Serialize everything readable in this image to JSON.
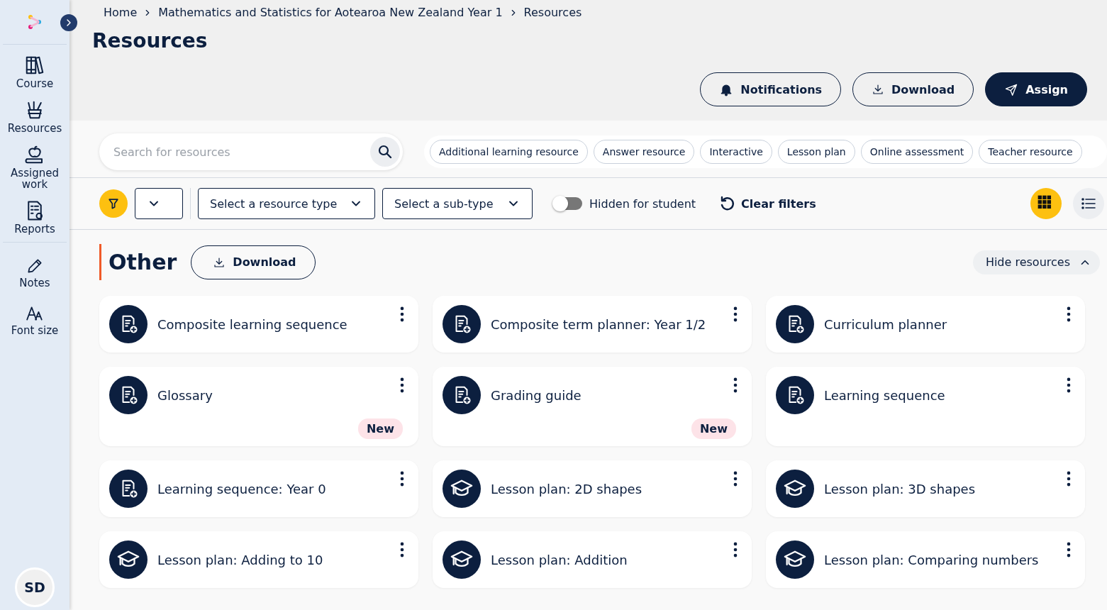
{
  "sidebar": {
    "items": [
      {
        "label": "Course"
      },
      {
        "label": "Resources"
      },
      {
        "label": "Assigned work"
      },
      {
        "label": "Reports"
      }
    ],
    "tools": [
      {
        "label": "Notes"
      },
      {
        "label": "Font size"
      }
    ],
    "avatar": "SD"
  },
  "breadcrumbs": [
    "Home",
    "Mathematics and Statistics for Aotearoa New Zealand Year 1",
    "Resources"
  ],
  "page_title": "Resources",
  "header_buttons": [
    {
      "label": "Notifications",
      "kind": "outline"
    },
    {
      "label": "Download",
      "kind": "outline"
    },
    {
      "label": "Assign",
      "kind": "filled"
    }
  ],
  "search": {
    "placeholder": "Search for resources"
  },
  "chips": [
    "Additional learning resource",
    "Answer resource",
    "Interactive",
    "Lesson plan",
    "Online assessment",
    "Teacher resource"
  ],
  "filters": {
    "resource_type": "Select a resource type",
    "sub_type": "Select a sub-type",
    "hidden_toggle": {
      "label": "Hidden for student",
      "on": false
    },
    "clear": "Clear filters"
  },
  "views": [
    {
      "kind": "grid",
      "selected": true
    },
    {
      "kind": "list",
      "selected": false
    }
  ],
  "section": {
    "title": "Other",
    "download": "Download",
    "hide": "Hide resources"
  },
  "cards": [
    {
      "title": "Composite learning sequence",
      "kind": "document"
    },
    {
      "title": "Composite term planner: Year 1/2",
      "kind": "document"
    },
    {
      "title": "Curriculum planner",
      "kind": "document"
    },
    {
      "title": "Glossary",
      "kind": "document",
      "badge": "New"
    },
    {
      "title": "Grading guide",
      "kind": "document",
      "badge": "New"
    },
    {
      "title": "Learning sequence",
      "kind": "document"
    },
    {
      "title": "Learning sequence: Year 0",
      "kind": "document"
    },
    {
      "title": "Lesson plan: 2D shapes",
      "kind": "cap"
    },
    {
      "title": "Lesson plan: 3D shapes",
      "kind": "cap"
    },
    {
      "title": "Lesson plan: Adding to 10",
      "kind": "cap"
    },
    {
      "title": "Lesson plan: Addition",
      "kind": "cap"
    },
    {
      "title": "Lesson plan: Comparing numbers",
      "kind": "cap"
    }
  ]
}
